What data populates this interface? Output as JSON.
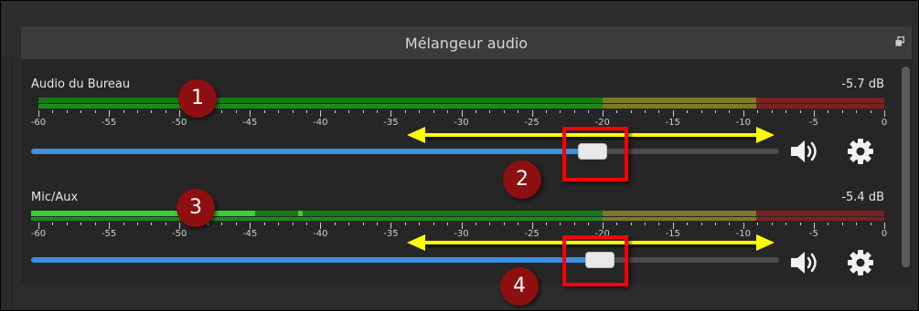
{
  "panel": {
    "title": "Mélangeur audio"
  },
  "ticks": [
    "-60",
    "-55",
    "-50",
    "-45",
    "-40",
    "-35",
    "-30",
    "-25",
    "-20",
    "-15",
    "-10",
    "-5",
    "0"
  ],
  "channels": [
    {
      "name": "Audio du Bureau",
      "db": "-5.7 dB"
    },
    {
      "name": "Mic/Aux",
      "db": "-5.4 dB"
    }
  ],
  "annotations": [
    "1",
    "2",
    "3",
    "4"
  ],
  "colors": {
    "accent": "#3d8fe0",
    "highlight": "#ff0000",
    "arrow": "#ffff00",
    "badge": "#8e0f0f"
  }
}
